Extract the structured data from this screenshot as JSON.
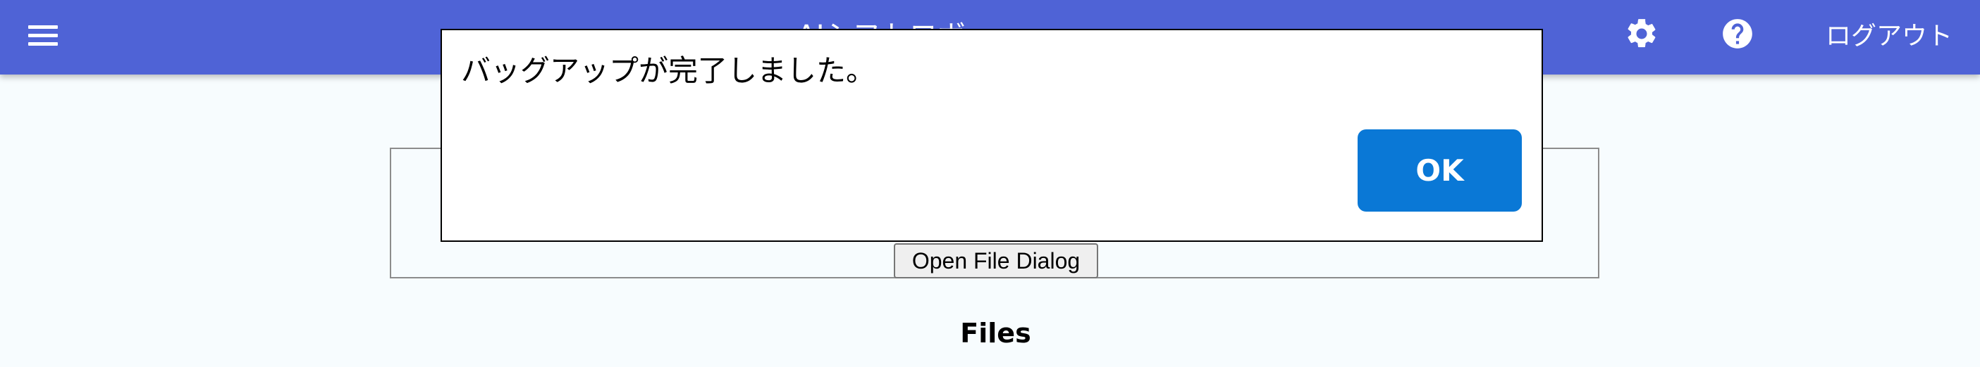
{
  "header": {
    "app_title": "AIシフトロボ",
    "logout_label": "ログアウト",
    "colors": {
      "background": "#4f63d6",
      "text": "#ffffff"
    },
    "icons": [
      "menu-icon",
      "gear-icon",
      "help-icon"
    ]
  },
  "upload": {
    "open_file_label": "Open File Dialog"
  },
  "files": {
    "heading": "Files"
  },
  "dialog": {
    "message": "バッグアップが完了しました。",
    "ok_label": "OK",
    "colors": {
      "ok_button": "#0a78d6"
    }
  }
}
